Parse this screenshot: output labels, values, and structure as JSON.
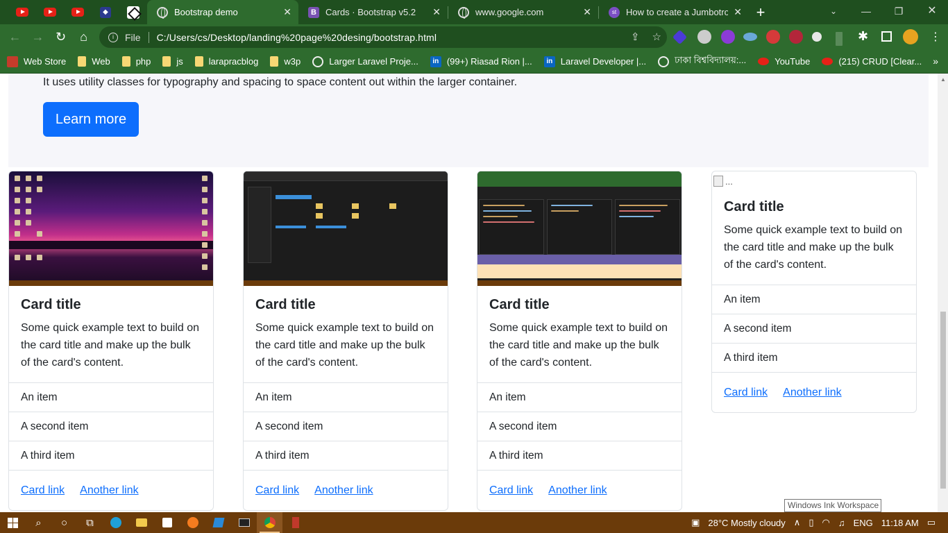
{
  "browser": {
    "pinned_tabs": [
      "youtube",
      "youtube",
      "youtube",
      "app",
      "app"
    ],
    "tabs": [
      {
        "title": "Bootstrap demo",
        "active": true
      },
      {
        "title": "Cards · Bootstrap v5.2",
        "active": false
      },
      {
        "title": "www.google.com",
        "active": false
      },
      {
        "title": "How to create a Jumbotron",
        "active": false
      }
    ],
    "address": {
      "scheme_label": "File",
      "url": "C:/Users/cs/Desktop/landing%20page%20desing/bootstrap.html"
    },
    "bookmarks": [
      {
        "label": "Web Store",
        "icon": "store"
      },
      {
        "label": "Web",
        "icon": "folder"
      },
      {
        "label": "php",
        "icon": "folder"
      },
      {
        "label": "js",
        "icon": "folder"
      },
      {
        "label": "larapracblog",
        "icon": "folder"
      },
      {
        "label": "w3p",
        "icon": "folder"
      },
      {
        "label": "Larger Laravel Proje...",
        "icon": "globe"
      },
      {
        "label": "(99+) Riasad Rion |...",
        "icon": "linkedin"
      },
      {
        "label": "Laravel Developer |...",
        "icon": "linkedin"
      },
      {
        "label": "ঢাকা বিশ্ববিদ্যালয়:...",
        "icon": "globe"
      },
      {
        "label": "YouTube",
        "icon": "youtube"
      },
      {
        "label": "(215) CRUD [Clear...",
        "icon": "youtube"
      }
    ],
    "bookmarks_more": "»"
  },
  "page": {
    "jumbotron": {
      "text": "It uses utility classes for typography and spacing to space content out within the larger container.",
      "button_label": "Learn more"
    },
    "cards": [
      {
        "image": "desktop-screenshot",
        "title": "Card title",
        "text": "Some quick example text to build on the card title and make up the bulk of the card's content.",
        "items": [
          "An item",
          "A second item",
          "A third item"
        ],
        "links": [
          "Card link",
          "Another link"
        ]
      },
      {
        "image": "file-explorer-screenshot",
        "title": "Card title",
        "text": "Some quick example text to build on the card title and make up the bulk of the card's content.",
        "items": [
          "An item",
          "A second item",
          "A third item"
        ],
        "links": [
          "Card link",
          "Another link"
        ]
      },
      {
        "image": "code-editor-screenshot",
        "title": "Card title",
        "text": "Some quick example text to build on the card title and make up the bulk of the card's content.",
        "items": [
          "An item",
          "A second item",
          "A third item"
        ],
        "links": [
          "Card link",
          "Another link"
        ]
      },
      {
        "image": "broken-image",
        "image_alt": "...",
        "title": "Card title",
        "text": "Some quick example text to build on the card title and make up the bulk of the card's content.",
        "items": [
          "An item",
          "A second item",
          "A third item"
        ],
        "links": [
          "Card link",
          "Another link"
        ]
      }
    ],
    "tooltip": "Windows Ink Workspace"
  },
  "taskbar": {
    "weather": "28°C  Mostly cloudy",
    "language": "ENG",
    "time": "11:18 AM"
  },
  "colors": {
    "chrome_dark": "#1f4f1f",
    "chrome_light": "#2e6b2e",
    "primary": "#0d6efd",
    "taskbar": "#6b3b0a"
  }
}
